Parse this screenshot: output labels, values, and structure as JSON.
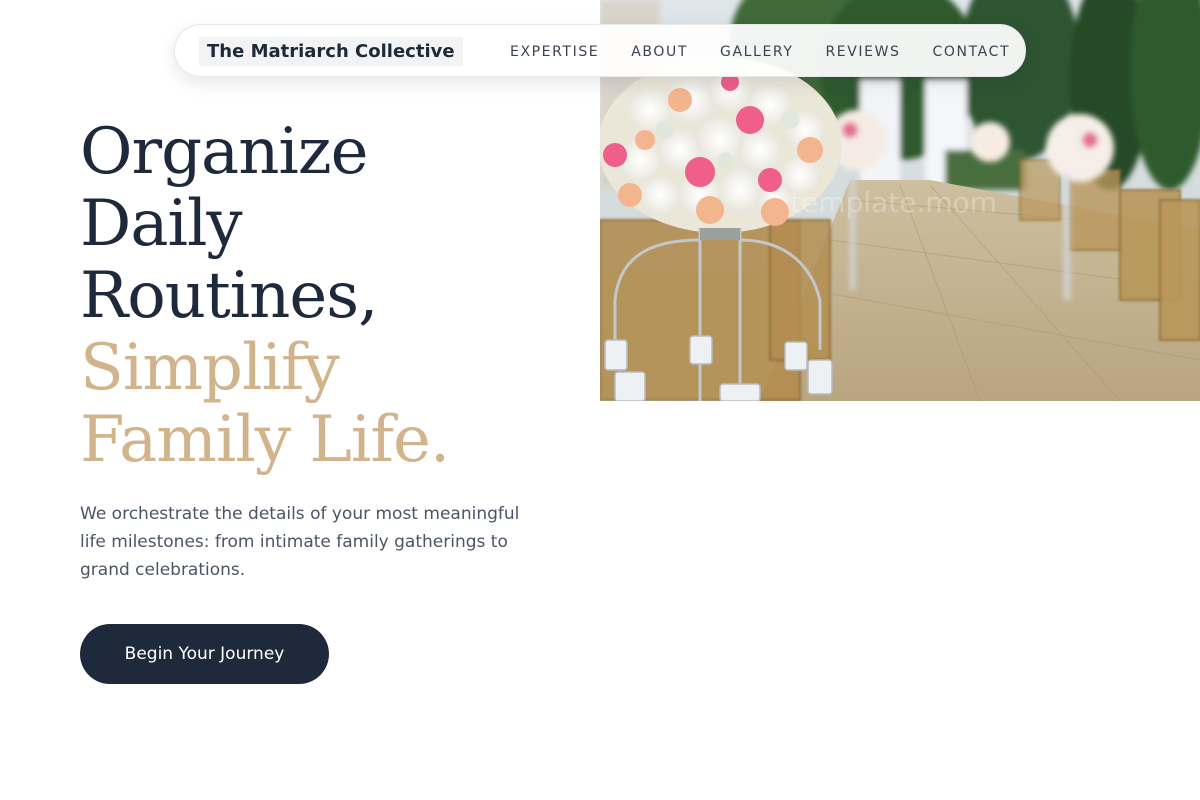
{
  "brand": {
    "name": "The Matriarch Collective"
  },
  "nav": {
    "links": [
      {
        "label": "EXPERTISE"
      },
      {
        "label": "ABOUT"
      },
      {
        "label": "GALLERY"
      },
      {
        "label": "REVIEWS"
      },
      {
        "label": "CONTACT"
      }
    ]
  },
  "hero": {
    "headline_lines": [
      "Organize",
      "Daily",
      "Routines,"
    ],
    "accent_lines": [
      "Simplify",
      "Family Life."
    ],
    "lead": "We orchestrate the details of your most meaningful life milestones: from intimate family gatherings to grand celebrations.",
    "cta_label": "Begin Your Journey",
    "image_subject": "outdoor wedding aisle with floral centerpieces and rows of chairs",
    "watermark": "template.mom"
  },
  "colors": {
    "dark": "#1e293b",
    "accent": "#d2b48c",
    "body_text": "#4b5563",
    "nav_text": "#3b4252"
  }
}
